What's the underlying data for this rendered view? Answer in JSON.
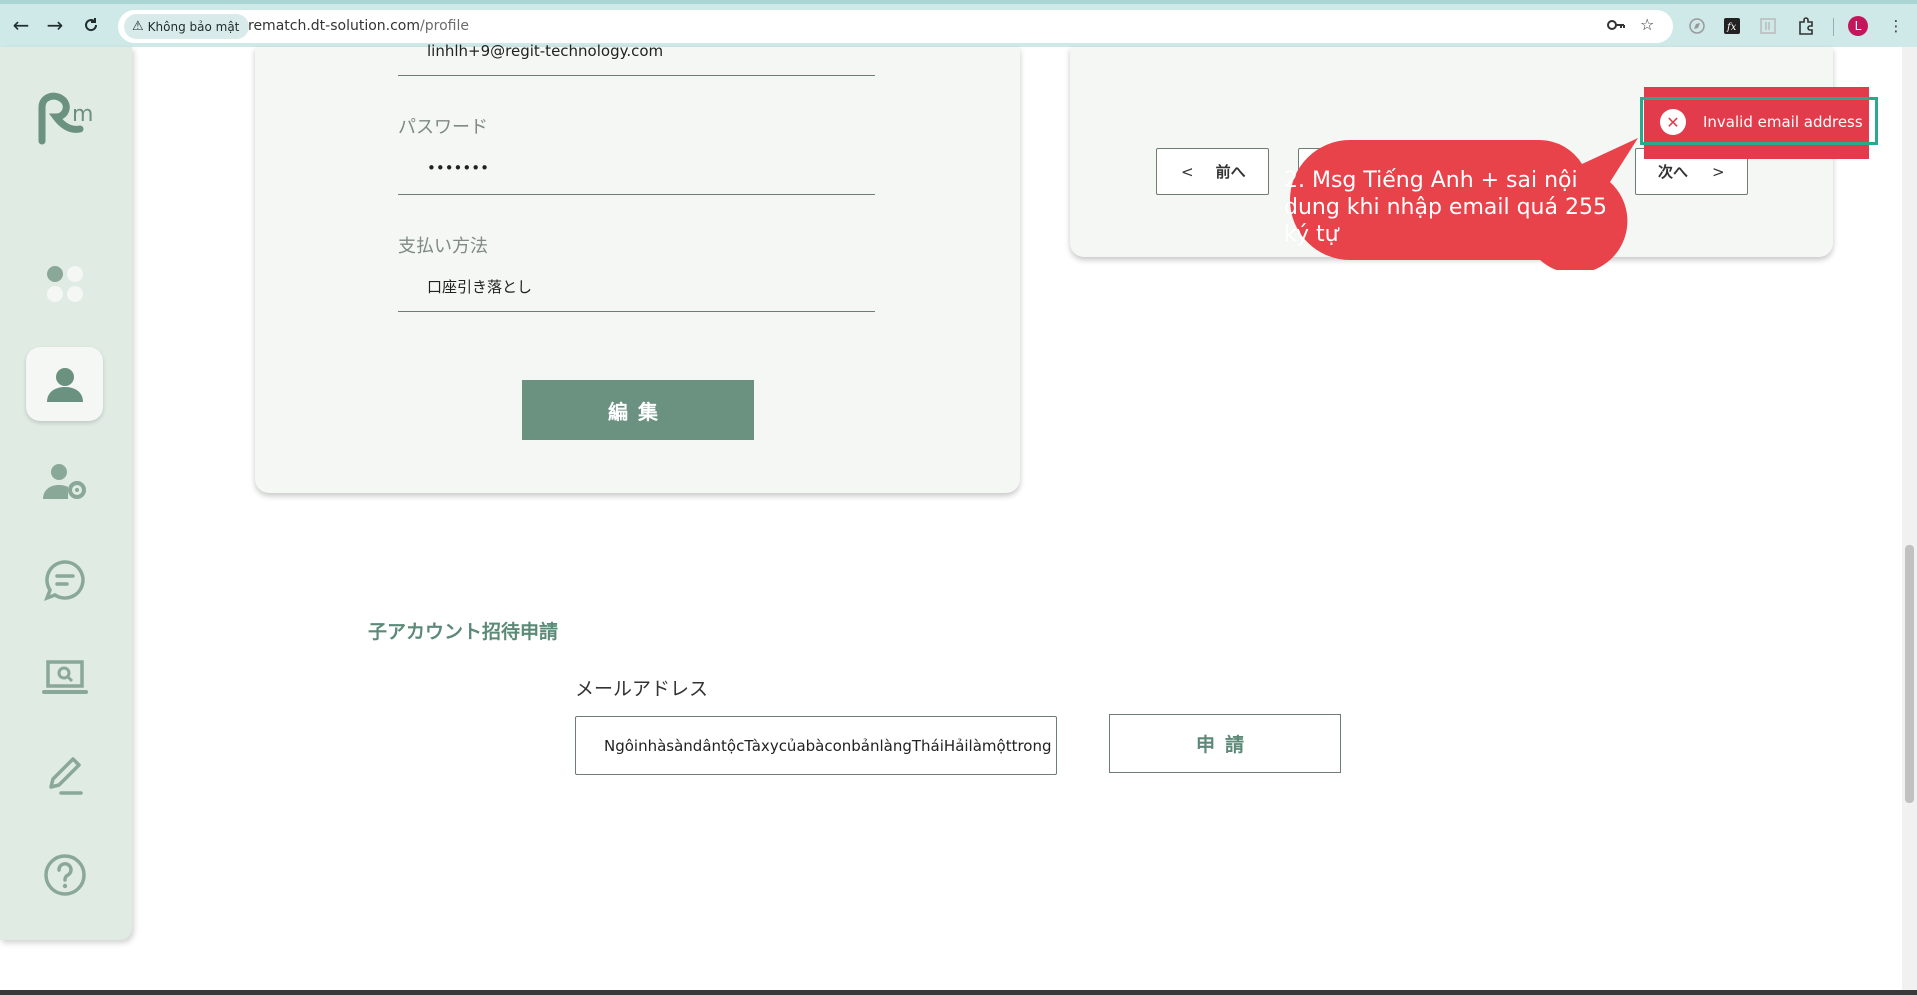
{
  "browser": {
    "security_label": "Không bảo mật",
    "url_host": "rematch.dt-solution.com",
    "url_path": "/profile",
    "avatar_letter": "L"
  },
  "profile_card": {
    "email_value": "linhlh+9@regit-technology.com",
    "password_label": "パスワード",
    "password_value": "•••••••",
    "payment_label": "支払い方法",
    "payment_value": "口座引き落とし",
    "edit_button": "編集"
  },
  "pagination": {
    "prev_label": "前へ",
    "next_label": "次へ"
  },
  "toast": {
    "message": "Invalid email address",
    "color": "#e23b4b"
  },
  "annotation": {
    "text": "2. Msg Tiếng Anh + sai nội dung khi nhập email quá 255 ký tự"
  },
  "invite": {
    "section_title": "子アカウント招待申請",
    "email_label": "メールアドレス",
    "email_value": "NgôinhàsàndântộcTàxycủabàconbảnlàngTháiHảilàmộttrong",
    "apply_button": "申請"
  },
  "sidebar": {
    "items": [
      {
        "icon": "dashboard-icon"
      },
      {
        "icon": "user-icon",
        "active": true
      },
      {
        "icon": "user-settings-icon"
      },
      {
        "icon": "chat-icon"
      },
      {
        "icon": "laptop-search-icon"
      },
      {
        "icon": "pencil-icon"
      },
      {
        "icon": "help-icon"
      }
    ]
  },
  "colors": {
    "accent": "#6b9180",
    "sidebar_bg": "#e0ebe4",
    "card_bg": "#f4f7f4"
  }
}
